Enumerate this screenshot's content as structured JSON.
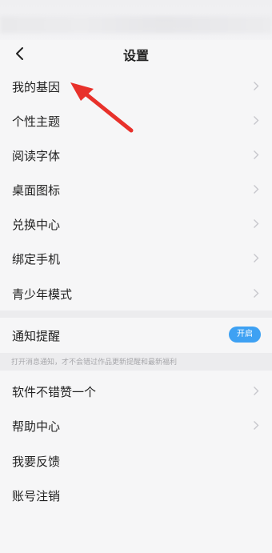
{
  "header": {
    "title": "设置"
  },
  "settings_group_1": [
    {
      "label": "我的基因"
    },
    {
      "label": "个性主题"
    },
    {
      "label": "阅读字体"
    },
    {
      "label": "桌面图标"
    },
    {
      "label": "兑换中心"
    },
    {
      "label": "绑定手机"
    },
    {
      "label": "青少年模式"
    }
  ],
  "notification": {
    "label": "通知提醒",
    "toggle_label": "开启",
    "hint": "打开消息通知，才不会错过作品更新提醒和最新福利"
  },
  "settings_group_2": [
    {
      "label": "软件不错赞一个"
    },
    {
      "label": "帮助中心"
    },
    {
      "label": "我要反馈"
    },
    {
      "label": "账号注销"
    }
  ],
  "colors": {
    "accent": "#3ea1f3",
    "annotation_arrow": "#e8312b"
  }
}
